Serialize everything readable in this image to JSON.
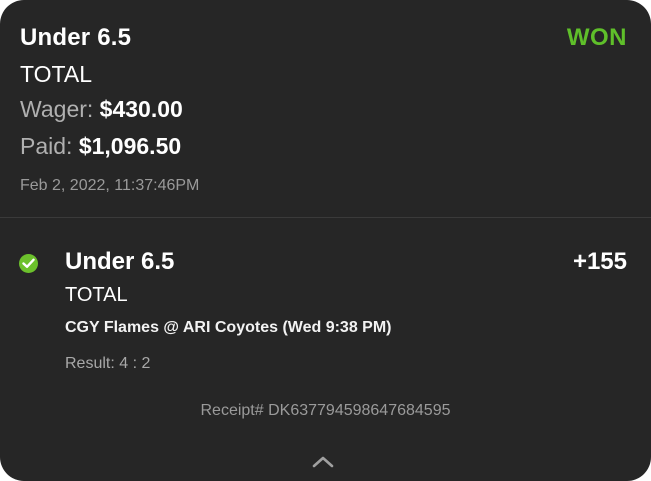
{
  "bet": {
    "title": "Under 6.5",
    "status": "WON",
    "type": "TOTAL",
    "wager_label": "Wager:",
    "wager_value": "$430.00",
    "paid_label": "Paid:",
    "paid_value": "$1,096.50",
    "placed_at": "Feb 2, 2022, 11:37:46PM"
  },
  "leg": {
    "title": "Under 6.5",
    "odds": "+155",
    "type": "TOTAL",
    "event": "CGY Flames @ ARI Coyotes (Wed 9:38 PM)",
    "result": "Result: 4 : 2",
    "status_icon": "check-circle-icon"
  },
  "receipt": {
    "text": "Receipt# DK637794598647684595"
  },
  "footer": {
    "collapse_icon": "chevron-up-icon"
  },
  "colors": {
    "background": "#262626",
    "won": "#5fbf2a",
    "check": "#6cc12c"
  }
}
